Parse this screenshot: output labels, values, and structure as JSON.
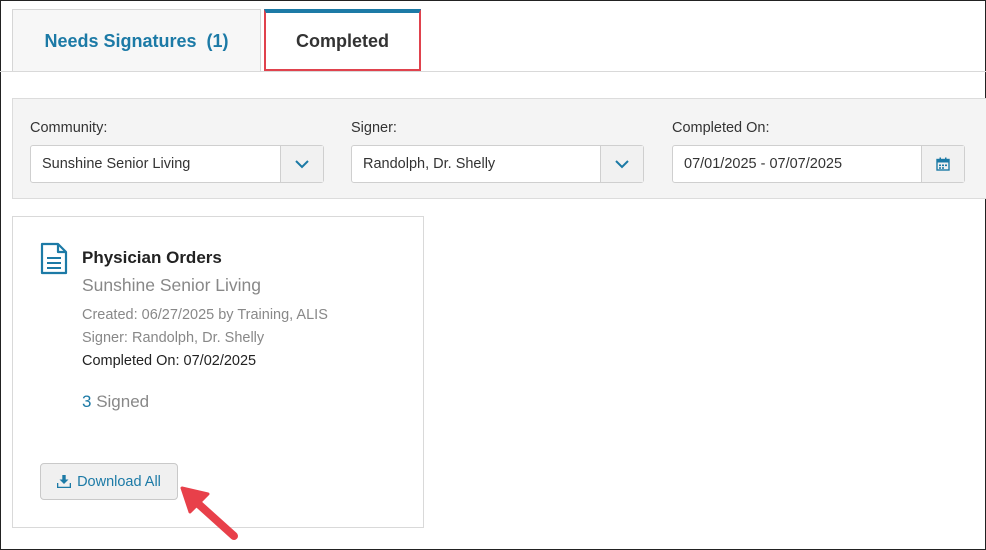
{
  "tabs": {
    "needs_signatures": {
      "label": "Needs Signatures",
      "count": "(1)"
    },
    "completed": {
      "label": "Completed"
    }
  },
  "filters": {
    "community": {
      "label": "Community:",
      "value": "Sunshine Senior Living"
    },
    "signer": {
      "label": "Signer:",
      "value": "Randolph, Dr. Shelly"
    },
    "completed_on": {
      "label": "Completed On:",
      "value": "07/01/2025 - 07/07/2025"
    }
  },
  "card": {
    "title": "Physician Orders",
    "community": "Sunshine Senior Living",
    "created": "Created: 06/27/2025 by Training, ALIS",
    "signer": "Signer: Randolph, Dr. Shelly",
    "completed_on": "Completed On: 07/02/2025",
    "signed_count": "3",
    "signed_label": " Signed",
    "download_label": "Download All"
  },
  "colors": {
    "accent": "#1c7aa6",
    "highlight_border": "#e0424d",
    "annotation_arrow": "#e8404a"
  },
  "icons": {
    "chevron": "chevron-down-icon",
    "calendar": "calendar-icon",
    "document": "document-icon",
    "download": "download-icon",
    "arrow": "pointer-arrow-icon"
  }
}
